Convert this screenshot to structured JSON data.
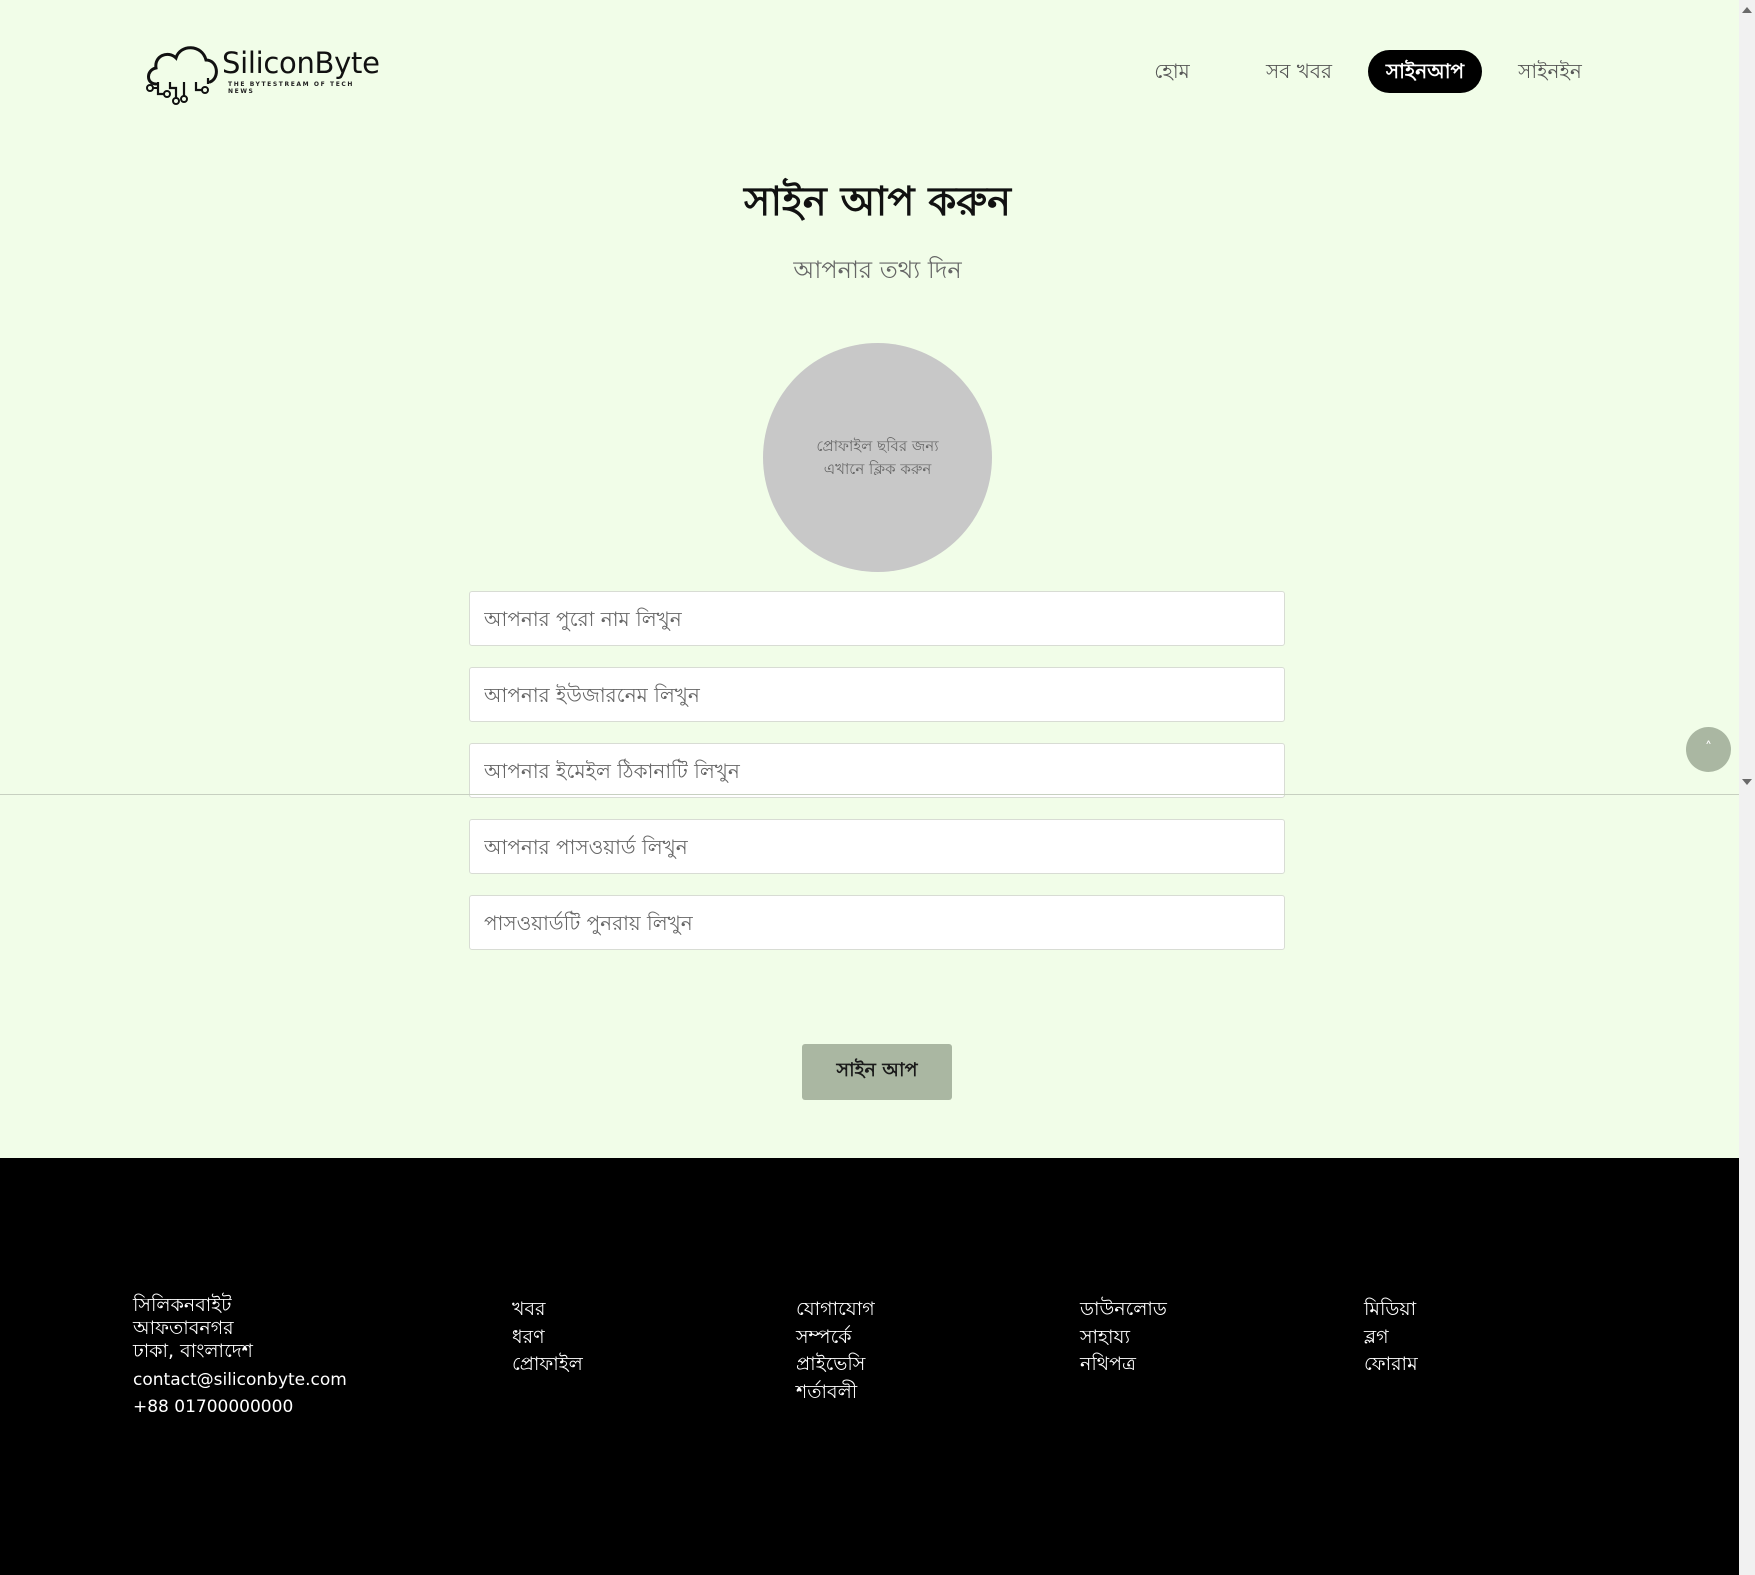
{
  "brand": {
    "name": "SiliconByte",
    "tagline": "THE BYTESTREAM OF TECH NEWS"
  },
  "nav": {
    "items": [
      {
        "label": "হোম"
      },
      {
        "label": "সব খবর"
      },
      {
        "label": "সাইনআপ",
        "active": true
      },
      {
        "label": "সাইনইন"
      }
    ]
  },
  "signup": {
    "title": "সাইন আপ করুন",
    "subtitle": "আপনার তথ্য দিন",
    "avatar_hint_line1": "প্রোফাইল ছবির জন্য",
    "avatar_hint_line2": "এখানে ক্লিক করুন",
    "fields": {
      "fullname_placeholder": "আপনার পুরো নাম লিখুন",
      "username_placeholder": "আপনার ইউজারনেম লিখুন",
      "email_placeholder": "আপনার ইমেইল ঠিকানাটি লিখুন",
      "password_placeholder": "আপনার পাসওয়ার্ড লিখুন",
      "confirm_placeholder": "পাসওয়ার্ডটি পুনরায় লিখুন"
    },
    "submit_label": "সাইন আপ"
  },
  "scroll_top_label": "˄",
  "footer": {
    "address": [
      "সিলিকনবাইট",
      "আফতাবনগর",
      "ঢাকা, বাংলাদেশ"
    ],
    "email": "contact@siliconbyte.com",
    "phone": "+88 01700000000",
    "columns": [
      [
        "খবর",
        "ধরণ",
        "প্রোফাইল"
      ],
      [
        "যোগাযোগ",
        "সম্পর্কে",
        "প্রাইভেসি",
        "শর্তাবলী"
      ],
      [
        "ডাউনলোড",
        "সাহায্য",
        "নথিপত্র"
      ],
      [
        "মিডিয়া",
        "ব্লগ",
        "ফোরাম"
      ]
    ]
  },
  "colors": {
    "page_bg": "#f1fde8",
    "accent_button": "#aab7a2",
    "footer_bg": "#000000",
    "nav_active_bg": "#000000"
  },
  "icons": [
    "cloud-circuit-logo-icon",
    "chevron-up-icon",
    "scroll-up-arrow-icon",
    "scroll-down-arrow-icon"
  ]
}
